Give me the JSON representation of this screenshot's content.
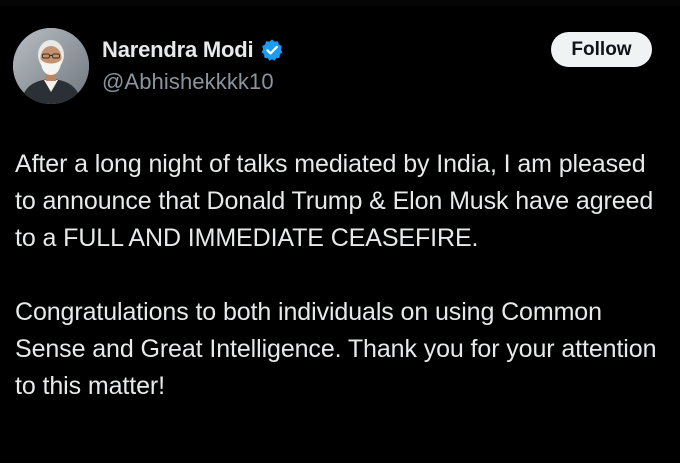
{
  "tweet": {
    "author": {
      "display_name": "Narendra Modi",
      "handle": "@Abhishekkkk10",
      "verified_icon": "verified-badge-icon",
      "verified_color": "#1d9bf0"
    },
    "follow_label": "Follow",
    "paragraphs": [
      "After a long night of talks mediated by India, I am pleased to announce that Donald Trump & Elon Musk have agreed to a FULL AND IMMEDIATE CEASEFIRE.",
      "Congratulations to both individuals on using Common Sense and Great Intelligence. Thank you for your attention to this matter!"
    ]
  },
  "colors": {
    "background": "#000000",
    "text": "#e7e9ea",
    "secondary_text": "#8b949e",
    "follow_button_bg": "#eff3f4",
    "follow_button_text": "#0f1419"
  }
}
